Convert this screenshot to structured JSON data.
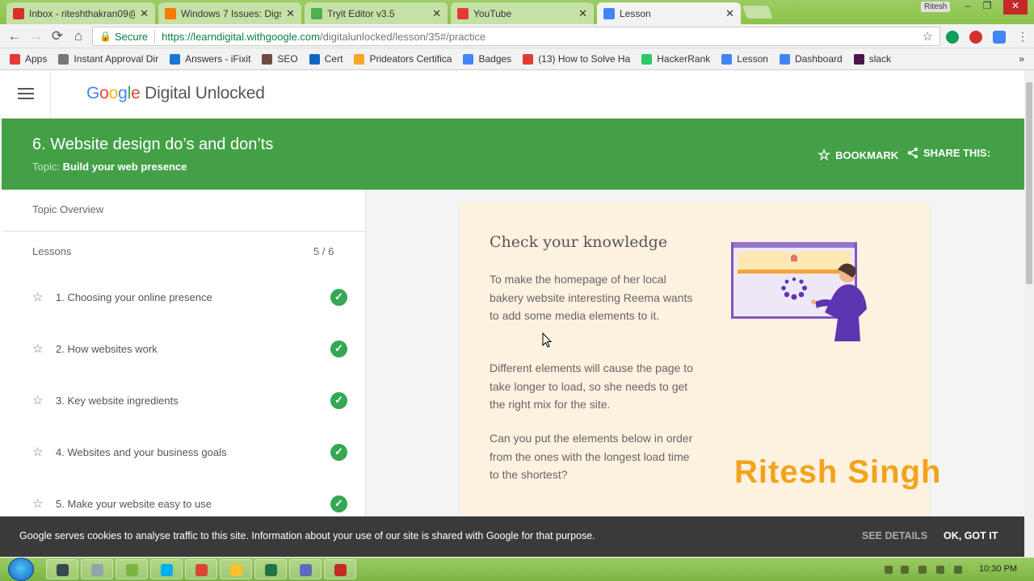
{
  "browser": {
    "tabs": [
      {
        "title": "Inbox - riteshthakran09@",
        "icon": "gmail-icon",
        "color": "#d93025",
        "active": false
      },
      {
        "title": "Windows 7 Issues: Digsb",
        "icon": "blogger-icon",
        "color": "#f57c00",
        "active": false
      },
      {
        "title": "Tryit Editor v3.5",
        "icon": "w3schools-icon",
        "color": "#4caf50",
        "active": false
      },
      {
        "title": "YouTube",
        "icon": "youtube-icon",
        "color": "#e53935",
        "active": false
      },
      {
        "title": "Lesson",
        "icon": "google-icon",
        "color": "#4285f4",
        "active": true
      }
    ],
    "user_badge": "Ritesh",
    "window_buttons": [
      "–",
      "❐",
      "✕"
    ],
    "nav": {
      "back": "←",
      "forward": "→",
      "reload": "⟳",
      "home": "⌂"
    },
    "address": {
      "secure_label": "Secure",
      "url_host": "https://learndigital.withgoogle.com",
      "url_path": "/digitalunlocked/lesson/35#/practice"
    },
    "bookmarks": [
      {
        "label": "Apps",
        "color": "#e53935",
        "icon": "apps-icon"
      },
      {
        "label": "Instant Approval Dir",
        "color": "#777777",
        "icon": "page-icon"
      },
      {
        "label": "Answers - iFixit",
        "color": "#1976d2",
        "icon": "ifixit-icon"
      },
      {
        "label": "SEO",
        "color": "#6d4c41",
        "icon": "seo-icon"
      },
      {
        "label": "Cert",
        "color": "#1565c0",
        "icon": "chart-icon"
      },
      {
        "label": "Prideators Certifica",
        "color": "#f9a825",
        "icon": "prideators-icon"
      },
      {
        "label": "Badges",
        "color": "#4285f4",
        "icon": "google-icon"
      },
      {
        "label": "(13) How to Solve Ha",
        "color": "#e53935",
        "icon": "youtube-icon"
      },
      {
        "label": "HackerRank",
        "color": "#2ec866",
        "icon": "hackerrank-icon"
      },
      {
        "label": "Lesson",
        "color": "#4285f4",
        "icon": "google-icon"
      },
      {
        "label": "Dashboard",
        "color": "#4285f4",
        "icon": "google-icon"
      },
      {
        "label": "slack",
        "color": "#4a154b",
        "icon": "slack-icon"
      }
    ],
    "bookmarks_overflow": "»"
  },
  "site": {
    "logo_google": "Google",
    "logo_rest": " Digital Unlocked"
  },
  "lesson_header": {
    "title": "6. Website design do’s and don’ts",
    "topic_label": "Topic:",
    "topic_value": "Build your web presence",
    "bookmark_label": "BOOKMARK",
    "share_label": "SHARE THIS:"
  },
  "sidebar": {
    "overview_label": "Topic Overview",
    "lessons_label": "Lessons",
    "lessons_count": "5 / 6",
    "lessons": [
      {
        "label": "1. Choosing your online presence",
        "completed": true
      },
      {
        "label": "2. How websites work",
        "completed": true
      },
      {
        "label": "3. Key website ingredients",
        "completed": true
      },
      {
        "label": "4. Websites and your business goals",
        "completed": true
      },
      {
        "label": "5. Make your website easy to use",
        "completed": true
      }
    ]
  },
  "card": {
    "title": "Check your knowledge",
    "paragraphs": [
      "To make the homepage of her local bakery website interesting Reema wants to add some media elements to it.",
      "Different elements will cause the page to take longer to load, so she needs to get the right mix for the site.",
      "Can you put the elements below in order from the ones with the longest load time to the shortest?"
    ]
  },
  "watermark": "Ritesh Singh",
  "cookie_bar": {
    "text": "Google serves cookies to analyse traffic to this site. Information about your use of our site is shared with Google for that purpose.",
    "see_details": "SEE DETAILS",
    "ok": "OK, GOT IT"
  },
  "taskbar": {
    "clock": "10:30 PM",
    "items": [
      {
        "name": "taskbar-app-1",
        "color": "#37474f"
      },
      {
        "name": "taskbar-app-2",
        "color": "#90a4ae"
      },
      {
        "name": "taskbar-app-3",
        "color": "#7cb342"
      },
      {
        "name": "taskbar-skype",
        "color": "#00aff0"
      },
      {
        "name": "taskbar-chrome",
        "color": "#db4437"
      },
      {
        "name": "taskbar-explorer",
        "color": "#fbc02d"
      },
      {
        "name": "taskbar-excel",
        "color": "#217346"
      },
      {
        "name": "taskbar-app-8",
        "color": "#5c6bc0"
      },
      {
        "name": "taskbar-recorder",
        "color": "#c62828"
      }
    ]
  }
}
